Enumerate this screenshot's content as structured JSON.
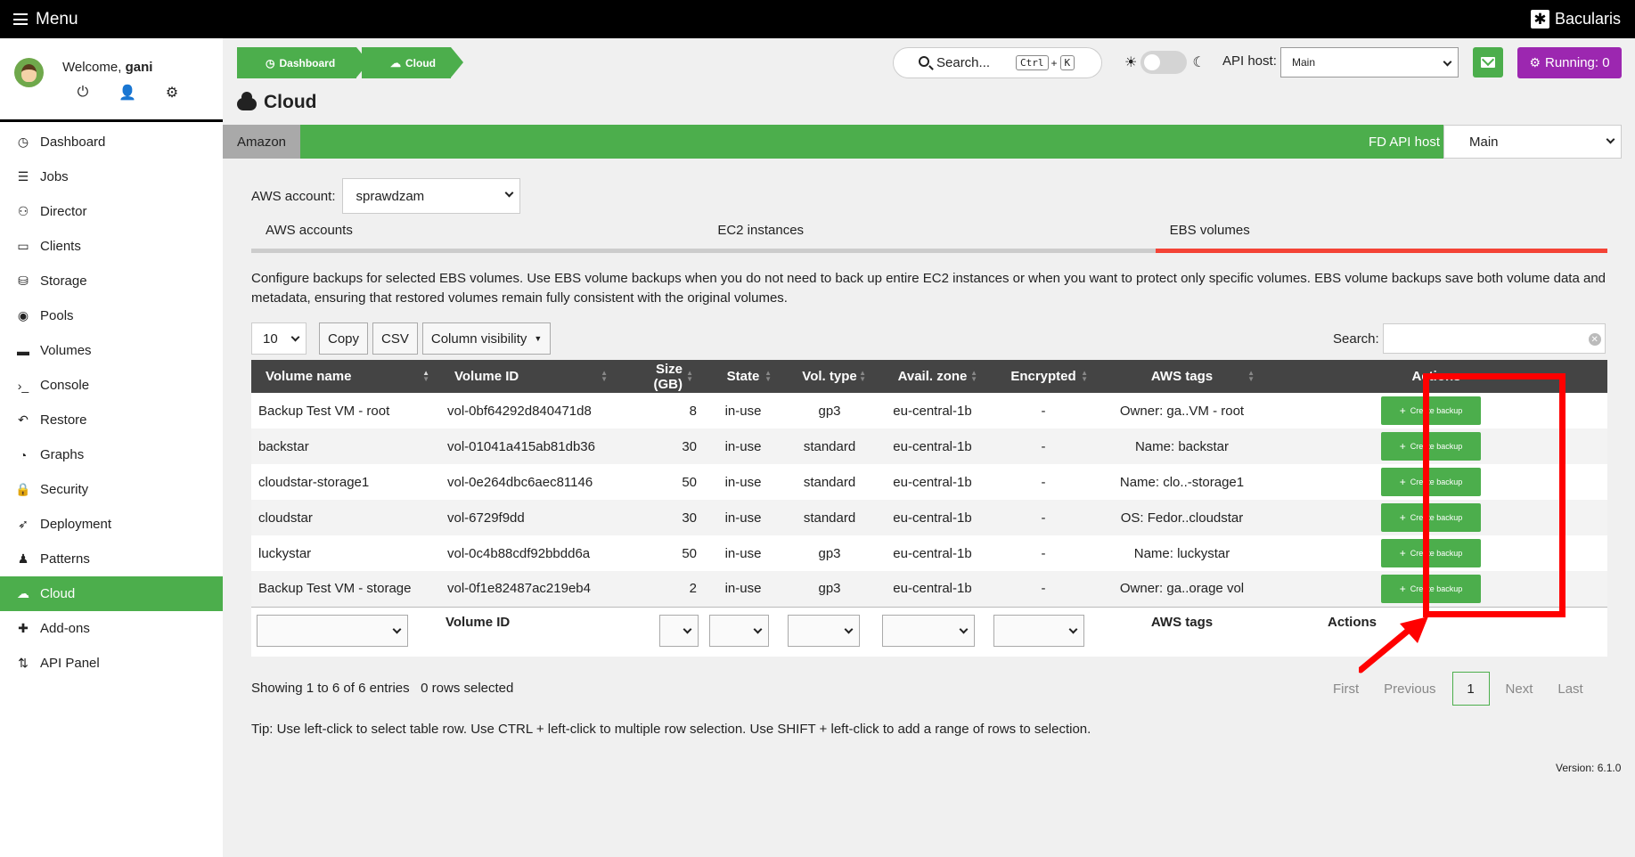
{
  "topbar": {
    "menu_label": "Menu",
    "brand": "Bacularis"
  },
  "user": {
    "welcome_prefix": "Welcome,",
    "username": "gani"
  },
  "sidebar": {
    "items": [
      {
        "label": "Dashboard",
        "icon": "dashboard-icon",
        "glyph": "◷"
      },
      {
        "label": "Jobs",
        "icon": "jobs-icon",
        "glyph": "☰"
      },
      {
        "label": "Director",
        "icon": "director-icon",
        "glyph": "⚇"
      },
      {
        "label": "Clients",
        "icon": "clients-icon",
        "glyph": "▭"
      },
      {
        "label": "Storage",
        "icon": "storage-icon",
        "glyph": "⛁"
      },
      {
        "label": "Pools",
        "icon": "pools-icon",
        "glyph": "◉"
      },
      {
        "label": "Volumes",
        "icon": "volumes-icon",
        "glyph": "▬"
      },
      {
        "label": "Console",
        "icon": "console-icon",
        "glyph": "›_"
      },
      {
        "label": "Restore",
        "icon": "restore-icon",
        "glyph": "↶"
      },
      {
        "label": "Graphs",
        "icon": "graphs-icon",
        "glyph": "◔"
      },
      {
        "label": "Security",
        "icon": "lock-icon",
        "glyph": "🔒"
      },
      {
        "label": "Deployment",
        "icon": "rocket-icon",
        "glyph": "➶"
      },
      {
        "label": "Patterns",
        "icon": "patterns-icon",
        "glyph": "♟"
      },
      {
        "label": "Cloud",
        "icon": "cloud-icon",
        "glyph": "☁",
        "active": true
      },
      {
        "label": "Add-ons",
        "icon": "puzzle-icon",
        "glyph": "✚"
      },
      {
        "label": "API Panel",
        "icon": "api-panel-icon",
        "glyph": "⇅"
      }
    ]
  },
  "breadcrumbs": [
    {
      "label": "Dashboard"
    },
    {
      "label": "Cloud"
    }
  ],
  "header": {
    "search_label": "Search...",
    "kbd_ctrl": "Ctrl",
    "kbd_plus": "+",
    "kbd_key": "K",
    "api_host_label": "API host:",
    "api_host_value": "Main",
    "running_label": "Running: 0"
  },
  "page": {
    "title": "Cloud"
  },
  "provider_bar": {
    "tab": "Amazon",
    "fd_label": "FD API host",
    "fd_value": "Main"
  },
  "aws": {
    "account_label": "AWS account:",
    "account_value": "sprawdzam",
    "tabs": [
      "AWS accounts",
      "EC2 instances",
      "EBS volumes"
    ],
    "active_tab": "EBS volumes",
    "description": "Configure backups for selected EBS volumes. Use EBS volume backups when you do not need to back up entire EC2 instances or when you want to protect only specific volumes. EBS volume backups save both volume data and metadata, ensuring that restored volumes remain fully consistent with the original volumes."
  },
  "table_controls": {
    "page_length": "10",
    "copy": "Copy",
    "csv": "CSV",
    "column_visibility": "Column visibility",
    "search_label": "Search:"
  },
  "table": {
    "columns": [
      "Volume name",
      "Volume ID",
      "Size (GB)",
      "State",
      "Vol. type",
      "Avail. zone",
      "Encrypted",
      "AWS tags",
      "Actions"
    ],
    "action_label": "Create backup",
    "rows": [
      {
        "name": "Backup Test VM - root",
        "id": "vol-0bf64292d840471d8",
        "size": "8",
        "state": "in-use",
        "type": "gp3",
        "zone": "eu-central-1b",
        "encrypted": "-",
        "tags": "Owner: ga..VM - root"
      },
      {
        "name": "backstar",
        "id": "vol-01041a415ab81db36",
        "size": "30",
        "state": "in-use",
        "type": "standard",
        "zone": "eu-central-1b",
        "encrypted": "-",
        "tags": "Name: backstar"
      },
      {
        "name": "cloudstar-storage1",
        "id": "vol-0e264dbc6aec81146",
        "size": "50",
        "state": "in-use",
        "type": "standard",
        "zone": "eu-central-1b",
        "encrypted": "-",
        "tags": "Name: clo..-storage1"
      },
      {
        "name": "cloudstar",
        "id": "vol-6729f9dd",
        "size": "30",
        "state": "in-use",
        "type": "standard",
        "zone": "eu-central-1b",
        "encrypted": "-",
        "tags": "OS: Fedor..cloudstar"
      },
      {
        "name": "luckystar",
        "id": "vol-0c4b88cdf92bbdd6a",
        "size": "50",
        "state": "in-use",
        "type": "gp3",
        "zone": "eu-central-1b",
        "encrypted": "-",
        "tags": "Name: luckystar"
      },
      {
        "name": "Backup Test VM - storage",
        "id": "vol-0f1e82487ac219eb4",
        "size": "2",
        "state": "in-use",
        "type": "gp3",
        "zone": "eu-central-1b",
        "encrypted": "-",
        "tags": "Owner: ga..orage vol"
      }
    ],
    "footer": {
      "volume_id": "Volume ID",
      "aws_tags": "AWS tags",
      "actions": "Actions"
    }
  },
  "pagination": {
    "info": "Showing 1 to 6 of 6 entries",
    "selected": "0 rows selected",
    "first": "First",
    "previous": "Previous",
    "current": "1",
    "next": "Next",
    "last": "Last"
  },
  "tip": "Tip: Use left-click to select table row. Use CTRL + left-click to multiple row selection. Use SHIFT + left-click to add a range of rows to selection.",
  "version": "Version: 6.1.0",
  "colors": {
    "green": "#4cae4c",
    "purple": "#9c27b0",
    "active_tab": "#f44336",
    "annotation": "#ff0000"
  }
}
